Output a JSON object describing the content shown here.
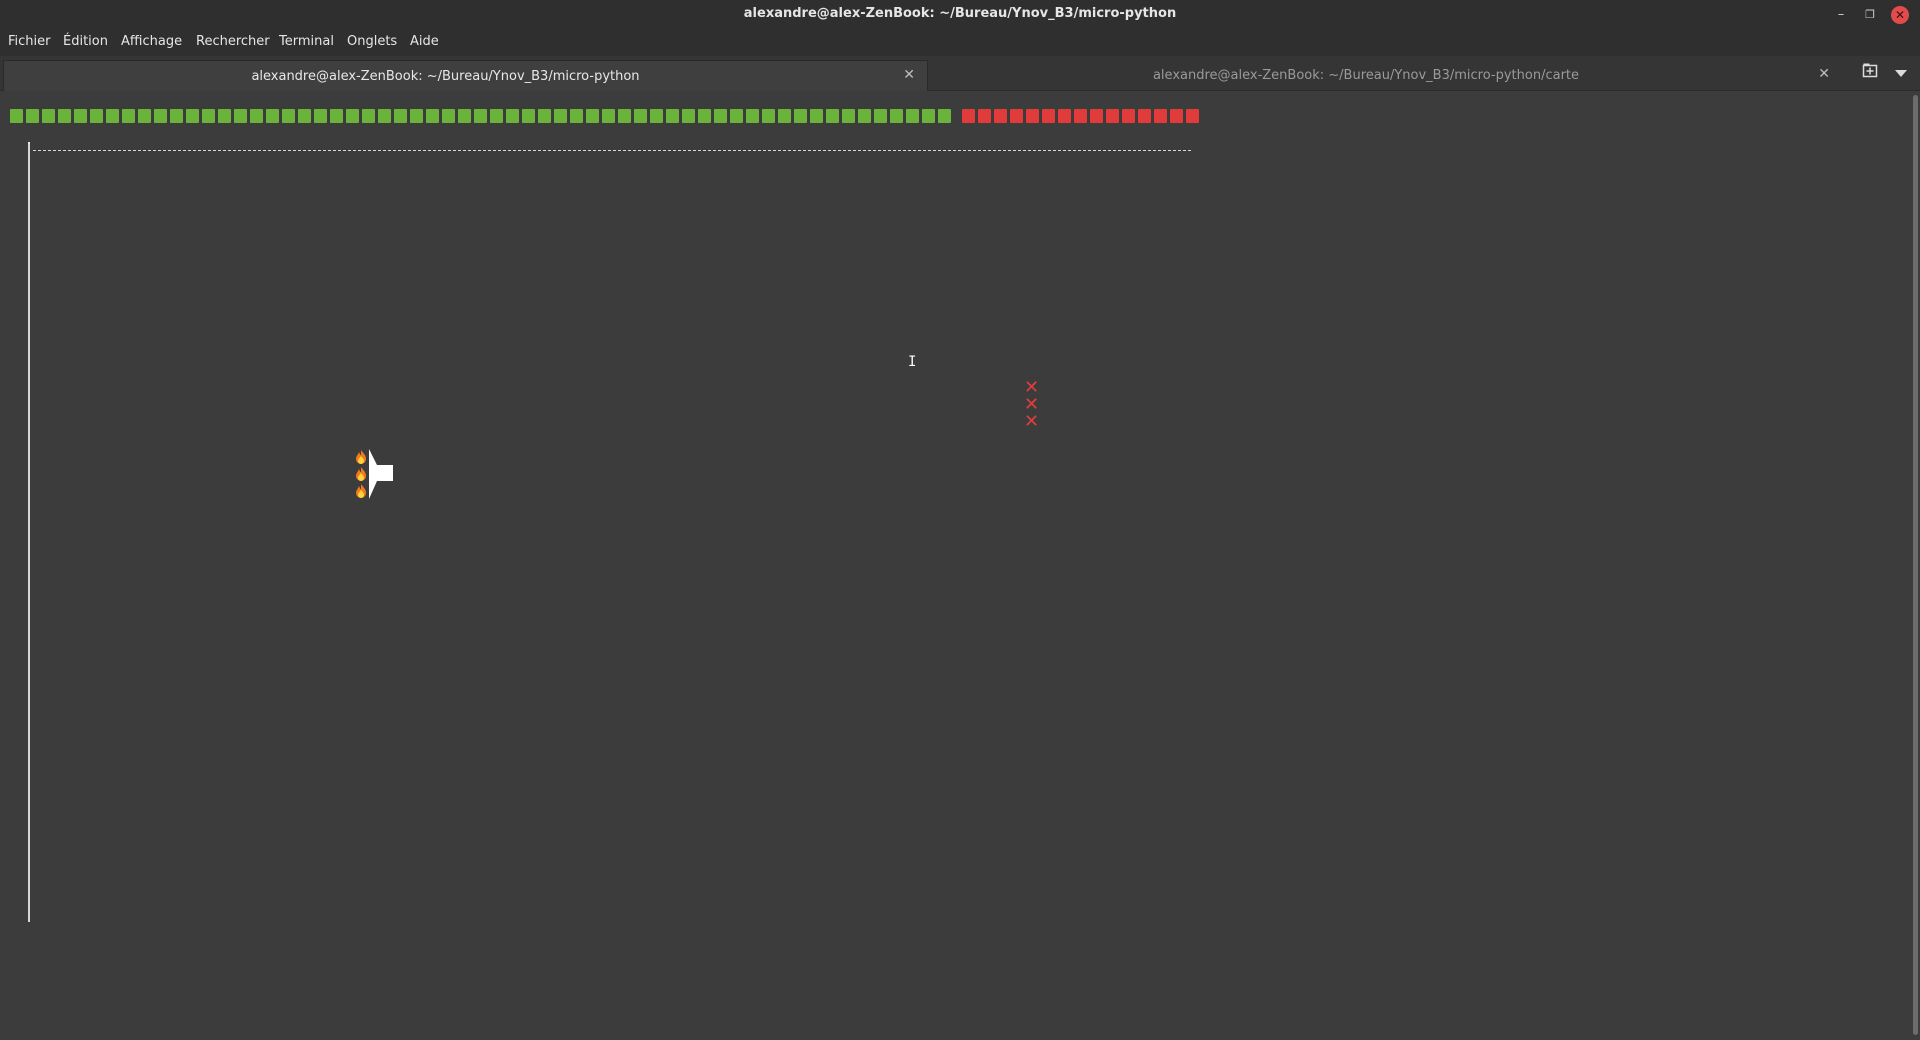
{
  "window": {
    "title": "alexandre@alex-ZenBook: ~/Bureau/Ynov_B3/micro-python",
    "controls": {
      "minimize": "–",
      "maximize": "❐",
      "close": "✕"
    }
  },
  "menu": [
    "Fichier",
    "Édition",
    "Affichage",
    "Rechercher",
    "Terminal",
    "Onglets",
    "Aide"
  ],
  "tabs": [
    {
      "label": "alexandre@alex-ZenBook: ~/Bureau/Ynov_B3/micro-python",
      "active": true,
      "close": "✕"
    },
    {
      "label": "alexandre@alex-ZenBook: ~/Bureau/Ynov_B3/micro-python/carte",
      "active": false,
      "close": "✕"
    }
  ],
  "tab_actions": {
    "new_tab_icon": "new-tab-icon",
    "dropdown_icon": "chevron-down-icon"
  },
  "game": {
    "health_bar": {
      "green_count": 59,
      "red_count": 15,
      "green_color": "#6ab43c",
      "red_color": "#e23b3b"
    },
    "enemies": [
      "✕",
      "✕",
      "✕"
    ],
    "player_flames": 3,
    "text_cursor": "I"
  },
  "colors": {
    "terminal_bg": "#3c3c3c",
    "titlebar_bg": "#2f2f2f",
    "close_button": "#e24b4b"
  }
}
